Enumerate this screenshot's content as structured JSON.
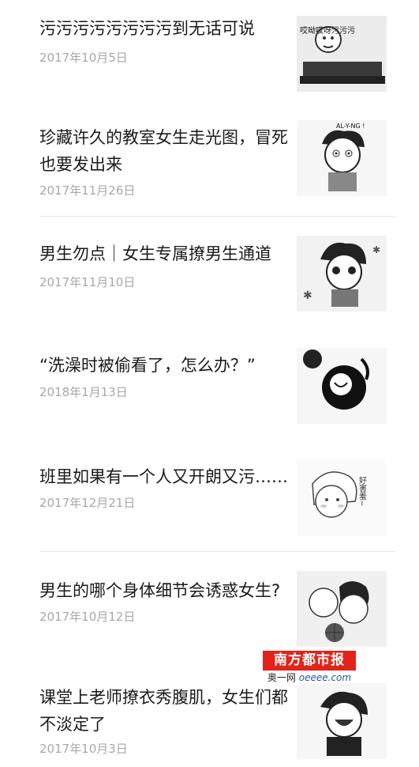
{
  "articles": [
    {
      "title": "污污污污污污污污到无话可说",
      "date": "2017年10月5日"
    },
    {
      "title": "珍藏许久的教室女生走光图，冒死也要发出来",
      "date": "2017年11月26日"
    },
    {
      "title": "男生勿点｜女生专属撩男生通道",
      "date": "2017年11月10日"
    },
    {
      "title": "“洗澡时被偷看了，怎么办？”",
      "date": "2018年1月13日"
    },
    {
      "title": "班里如果有一个人又开朗又污……",
      "date": "2017年12月21日"
    },
    {
      "title": "男生的哪个身体细节会诱惑女生?",
      "date": "2017年10月12日"
    },
    {
      "title": "课堂上老师撩衣秀腹肌，女生们都不淡定了",
      "date": "2017年10月3日"
    }
  ],
  "thumbnail_texts": {
    "t1": "哎呦哎呀污污污",
    "t2": "AL-Y-NG !",
    "t5": "好害羞~"
  },
  "watermark": {
    "brand": "南方都市报",
    "site": "奥一网",
    "url": "oeeee.com"
  }
}
